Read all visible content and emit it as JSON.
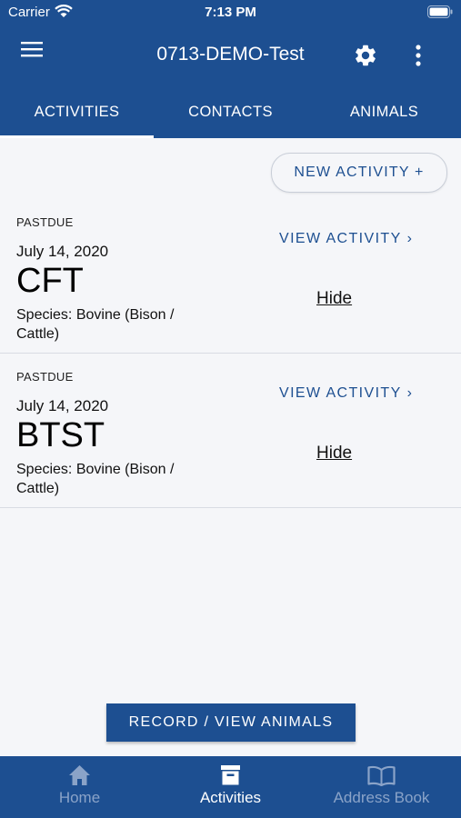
{
  "status_bar": {
    "carrier": "Carrier",
    "time": "7:13 PM"
  },
  "app_bar": {
    "title": "0713-DEMO-Test",
    "icons": [
      "menu-icon",
      "gear-icon",
      "more-vertical-icon"
    ]
  },
  "tabs": [
    {
      "label": "ACTIVITIES",
      "active": true
    },
    {
      "label": "CONTACTS",
      "active": false
    },
    {
      "label": "ANIMALS",
      "active": false
    }
  ],
  "new_activity_button": "NEW ACTIVITY +",
  "activities": [
    {
      "status": "PASTDUE",
      "date": "July 14, 2020",
      "type": "CFT",
      "species": "Species: Bovine (Bison / Cattle)",
      "view_label": "VIEW ACTIVITY",
      "hide_label": "Hide"
    },
    {
      "status": "PASTDUE",
      "date": "July 14, 2020",
      "type": "BTST",
      "species": "Species: Bovine (Bison / Cattle)",
      "view_label": "VIEW ACTIVITY",
      "hide_label": "Hide"
    }
  ],
  "record_button": "RECORD / VIEW ANIMALS",
  "bottom_nav": [
    {
      "label": "Home",
      "icon": "home-icon",
      "active": false
    },
    {
      "label": "Activities",
      "icon": "archive-box-icon",
      "active": true
    },
    {
      "label": "Address Book",
      "icon": "open-book-icon",
      "active": false
    }
  ],
  "colors": {
    "primary": "#1d4f91",
    "background": "#f5f6f9",
    "inactive_nav": "#8aa3c8"
  }
}
